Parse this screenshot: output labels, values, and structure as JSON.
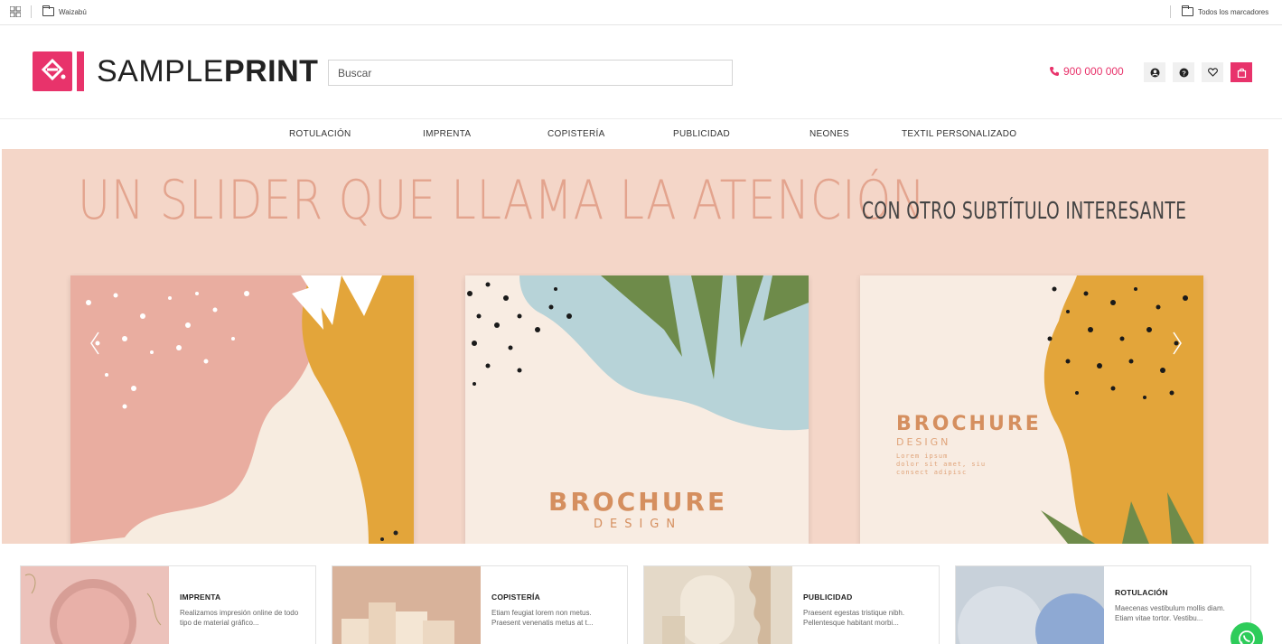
{
  "bookmarks": {
    "left_folder": "Waizabú",
    "right_folder": "Todos los marcadores"
  },
  "header": {
    "logo_light": "SAMPLE",
    "logo_bold": "PRINT",
    "search_placeholder": "Buscar",
    "phone": "900 000 000"
  },
  "nav": {
    "items": [
      "ROTULACIÓN",
      "IMPRENTA",
      "COPISTERÍA",
      "PUBLICIDAD",
      "NEONES",
      "TEXTIL PERSONALIZADO"
    ]
  },
  "slider": {
    "title": "UN SLIDER QUE LLAMA LA ATENCIÓN",
    "subtitle": "CON OTRO SUBTÍTULO INTERESANTE",
    "card_center_title": "BROCHURE",
    "card_center_sub": "DESIGN",
    "card_right_title": "BROCHURE",
    "card_right_sub": "DESIGN",
    "card_right_body": [
      "Lorem ipsum",
      "dolor sit amet, siu",
      "consect adipisc"
    ]
  },
  "categories": [
    {
      "title": "IMPRENTA",
      "desc": "Realizamos impresión online de todo tipo de material gráfico..."
    },
    {
      "title": "COPISTERÍA",
      "desc": "Etiam feugiat lorem non metus. Praesent venenatis metus at t..."
    },
    {
      "title": "PUBLICIDAD",
      "desc": "Praesent egestas tristique nibh. Pellentesque habitant morbi..."
    },
    {
      "title": "ROTULACIÓN",
      "desc": "Maecenas vestibulum mollis diam. Etiam vitae tortor. Vestibu..."
    }
  ],
  "colors": {
    "brand": "#e8336b",
    "slider_bg": "#f4d6c8",
    "whatsapp": "#2ecc5a"
  },
  "icons": [
    "apps-icon",
    "folder-icon",
    "phone-icon",
    "user-icon",
    "help-icon",
    "heart-icon",
    "bag-icon",
    "whatsapp-icon",
    "chevron-left-icon",
    "chevron-right-icon"
  ]
}
